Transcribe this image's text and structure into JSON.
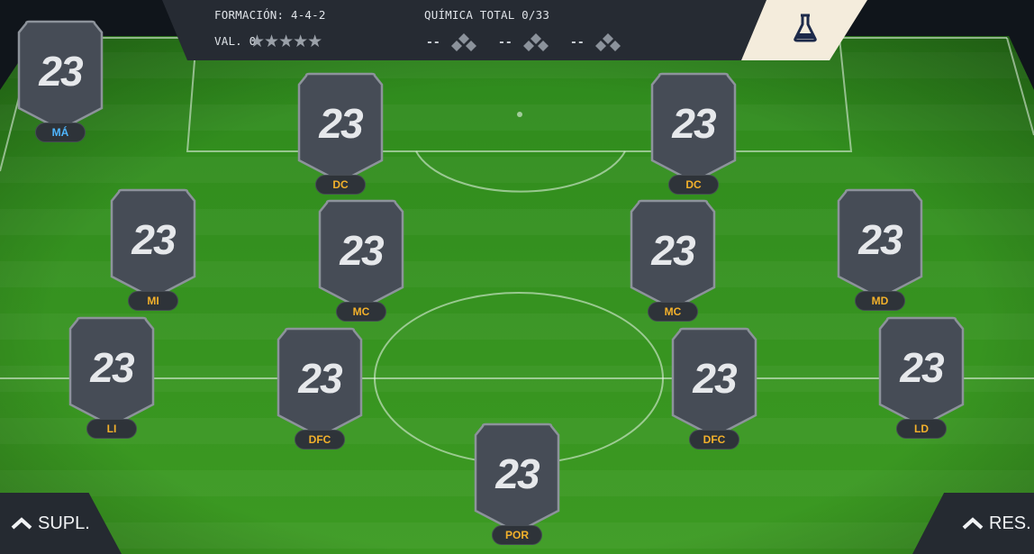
{
  "header": {
    "formation_label": "FORMACIÓN: 4-4-2",
    "value_label": "VAL. 0",
    "stars": "★★★★★",
    "chemistry_label": "QUÍMICA TOTAL 0/33",
    "chem_slots": [
      "--",
      "--",
      "--"
    ]
  },
  "players": [
    {
      "rating": "23",
      "position": "MÁ"
    },
    {
      "rating": "23",
      "position": "DC"
    },
    {
      "rating": "23",
      "position": "DC"
    },
    {
      "rating": "23",
      "position": "MI"
    },
    {
      "rating": "23",
      "position": "MC"
    },
    {
      "rating": "23",
      "position": "MC"
    },
    {
      "rating": "23",
      "position": "MD"
    },
    {
      "rating": "23",
      "position": "LI"
    },
    {
      "rating": "23",
      "position": "DFC"
    },
    {
      "rating": "23",
      "position": "DFC"
    },
    {
      "rating": "23",
      "position": "LD"
    },
    {
      "rating": "23",
      "position": "POR"
    }
  ],
  "buttons": {
    "subs_label": "SUPL.",
    "reserves_label": "RES."
  },
  "colors": {
    "position_text": "#f3b12b",
    "manager_position_text": "#4fb6ff",
    "card_fill": "#464c56",
    "header_bg": "#262b33",
    "flask_bg": "#f4ecdc"
  },
  "icons": {
    "flask": "flask-icon",
    "chemistry": "chemistry-diamond-icon",
    "chevron": "chevron-up-icon",
    "star": "star-icon"
  }
}
